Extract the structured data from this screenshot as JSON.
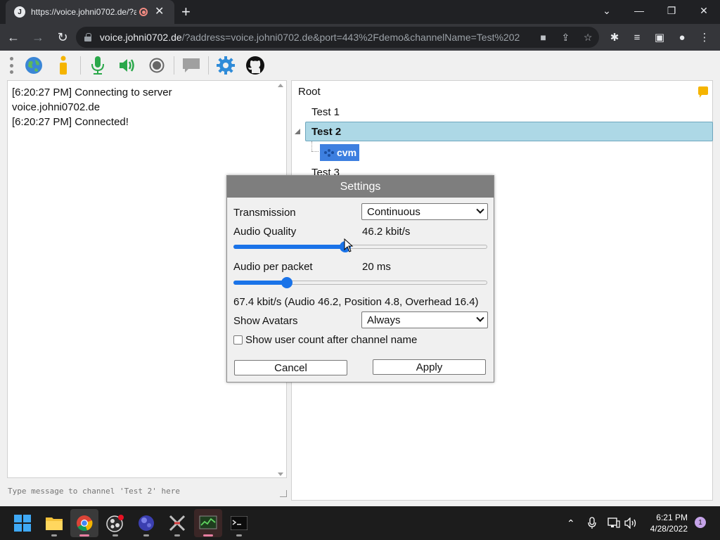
{
  "browser": {
    "tab_title": "https://voice.johni0702.de/?a",
    "tab_favicon": "J",
    "url_host": "voice.johni0702.de",
    "url_rest": "/?address=voice.johni0702.de&port=443%2Fdemo&channelName=Test%202",
    "icons": [
      "back-icon",
      "forward-icon",
      "reload-icon",
      "lock-icon",
      "camera-icon",
      "share-icon",
      "star-icon",
      "extensions-icon",
      "media-icon",
      "sidepanel-icon",
      "profile-icon",
      "menu-icon"
    ]
  },
  "app_toolbar": {
    "icons": [
      "connect-globe-icon",
      "info-icon",
      "microphone-icon",
      "speaker-icon",
      "record-icon",
      "chat-icon",
      "settings-gear-icon",
      "github-icon"
    ]
  },
  "chat": {
    "lines": [
      "[6:20:27 PM] Connecting to server voice.johni0702.de",
      "[6:20:27 PM] Connected!"
    ],
    "input_placeholder": "Type message to channel 'Test 2' here"
  },
  "tree": {
    "root": "Root",
    "channels": [
      "Test 1",
      "Test 2",
      "Test 3"
    ],
    "selected_channel": "Test 2",
    "user": "cvm"
  },
  "settings": {
    "title": "Settings",
    "transmission_label": "Transmission",
    "transmission_value": "Continuous",
    "audio_quality_label": "Audio Quality",
    "audio_quality_value": "46.2 kbit/s",
    "audio_quality_fraction": 0.44,
    "audio_packet_label": "Audio per packet",
    "audio_packet_value": "20 ms",
    "audio_packet_fraction": 0.21,
    "bitrate_summary": "67.4 kbit/s (Audio 46.2, Position 4.8, Overhead 16.4)",
    "avatars_label": "Show Avatars",
    "avatars_value": "Always",
    "user_count_label": "Show user count after channel name",
    "user_count_checked": false,
    "cancel_label": "Cancel",
    "apply_label": "Apply",
    "accent_color": "#1a73e8"
  },
  "taskbar": {
    "apps": [
      "windows-start-icon",
      "file-explorer-icon",
      "chrome-icon",
      "obs-icon",
      "app-globe-icon",
      "app-x-icon",
      "monitor-icon",
      "terminal-icon"
    ],
    "time": "6:21 PM",
    "date": "4/28/2022",
    "notification_count": "1"
  }
}
